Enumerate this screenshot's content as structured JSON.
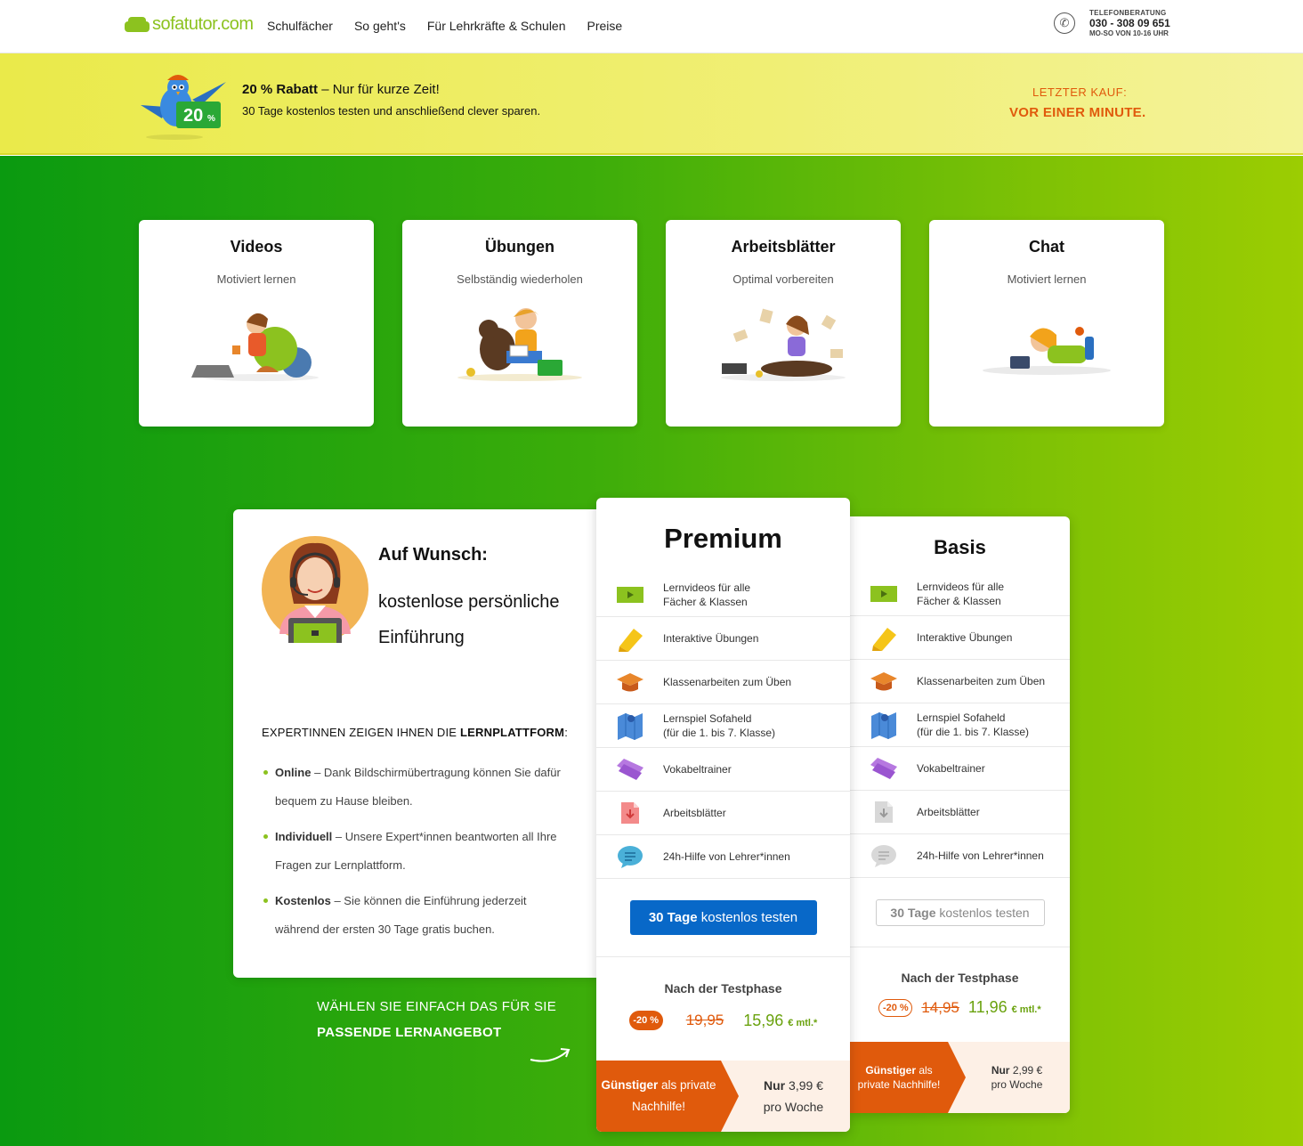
{
  "header": {
    "logo": "sofatutor.com",
    "nav": [
      "Schulfächer",
      "So geht's",
      "Für Lehrkräfte & Schulen",
      "Preise"
    ],
    "phone_label": "TELEFONBERATUNG",
    "phone_number": "030 - 308 09 651",
    "phone_hours": "MO-SO VON 10-16 UHR"
  },
  "promo": {
    "badge": "20",
    "title_bold": "20 % Rabatt",
    "title_rest": " – Nur für kurze Zeit!",
    "subtitle": "30 Tage kostenlos testen und anschließend clever sparen.",
    "last_label": "LETZTER KAUF:",
    "last_value": "VOR EINER MINUTE."
  },
  "features": [
    {
      "title": "Videos",
      "subtitle": "Motiviert lernen"
    },
    {
      "title": "Übungen",
      "subtitle": "Selbständig wiederholen"
    },
    {
      "title": "Arbeitsblätter",
      "subtitle": "Optimal vorbereiten"
    },
    {
      "title": "Chat",
      "subtitle": "Motiviert lernen"
    }
  ],
  "intro": {
    "wish_title": "Auf Wunsch:",
    "wish_text": "kostenlose persönliche Einführung",
    "expert_prefix": "EXPERTINNEN ZEIGEN IHNEN DIE ",
    "expert_bold": "LERNPLATTFORM",
    "expert_suffix": ":",
    "bullets": [
      {
        "bold": "Online",
        "text": " – Dank Bildschirmübertragung können Sie dafür bequem zu Hause bleiben."
      },
      {
        "bold": "Individuell",
        "text": " – Unsere Expert*innen beantworten all Ihre Fragen zur Lernplattform."
      },
      {
        "bold": "Kostenlos",
        "text": " – Sie können die Einführung jederzeit während der ersten 30 Tage gratis buchen."
      }
    ]
  },
  "choose": {
    "line1": "WÄHLEN SIE EINFACH DAS FÜR SIE",
    "line2": "PASSENDE LERNANGEBOT"
  },
  "plan_features": [
    {
      "line1": "Lernvideos für alle",
      "line2": "Fächer & Klassen",
      "icon": "video-icon"
    },
    {
      "line1": "Interaktive Übungen",
      "line2": "",
      "icon": "pencil-icon"
    },
    {
      "line1": "Klassenarbeiten zum Üben",
      "line2": "",
      "icon": "graduation-cap-icon"
    },
    {
      "line1": "Lernspiel Sofaheld",
      "line2": "(für die 1. bis 7. Klasse)",
      "icon": "map-icon"
    },
    {
      "line1": "Vokabeltrainer",
      "line2": "",
      "icon": "flashcards-icon"
    },
    {
      "line1": "Arbeitsblätter",
      "line2": "",
      "icon": "worksheet-icon"
    },
    {
      "line1": "24h-Hilfe von Lehrer*innen",
      "line2": "",
      "icon": "chat-bubble-icon"
    }
  ],
  "premium": {
    "title": "Premium",
    "cta_bold": "30 Tage",
    "cta_rest": " kostenlos testen",
    "after": "Nach der Testphase",
    "badge": "-20 %",
    "old_price": "19,95",
    "new_price": "15,96",
    "unit": "€ mtl.*",
    "cheap_bold": "Günstiger",
    "cheap_rest": " als private Nachhilfe!",
    "week_bold": "Nur",
    "week_price": " 3,99 €",
    "week_unit": "pro Woche"
  },
  "basis": {
    "title": "Basis",
    "cta_bold": "30 Tage",
    "cta_rest": " kostenlos testen",
    "after": "Nach der Testphase",
    "badge": "-20 %",
    "old_price": "14,95",
    "new_price": "11,96",
    "unit": "€ mtl.*",
    "cheap_bold": "Günstiger",
    "cheap_rest": " als private Nachhilfe!",
    "week_bold": "Nur",
    "week_price": " 2,99 €",
    "week_unit": "pro Woche"
  },
  "colors": {
    "brand_green": "#8cc21f",
    "accent_orange": "#e05a0c",
    "cta_blue": "#0868c8",
    "promo_yellow": "#eaea4a"
  }
}
